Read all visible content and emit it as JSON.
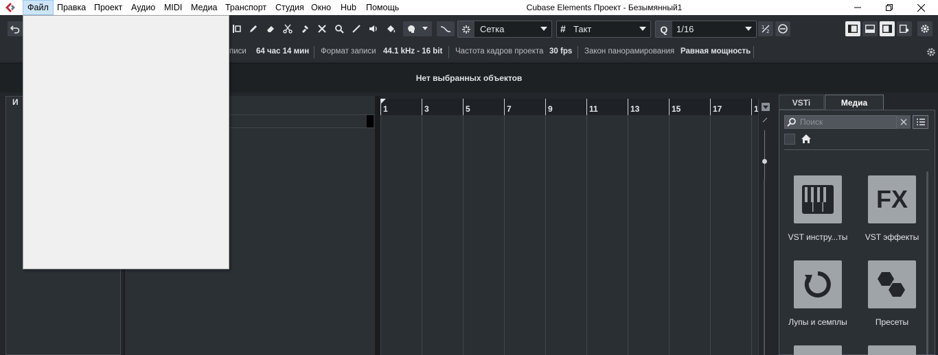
{
  "window": {
    "title": "Cubase Elements Проект - Безымянный1",
    "menu": [
      "Файл",
      "Правка",
      "Проект",
      "Аудио",
      "MIDI",
      "Медиа",
      "Транспорт",
      "Студия",
      "Окно",
      "Hub",
      "Помощь"
    ]
  },
  "toolbar": {
    "snap_type": "Сетка",
    "grid_type": "Такт",
    "quantize": "1/16"
  },
  "statusline": {
    "record_time_label_partial": "писи",
    "record_time_value": "64 час 14 мин",
    "record_format_label": "Формат записи",
    "record_format_value": "44.1 kHz - 16 bit",
    "frame_rate_label": "Частота кадров проекта",
    "frame_rate_value": "30 fps",
    "pan_law_label": "Закон панорамирования",
    "pan_law_value": "Равная мощность"
  },
  "infoline": {
    "text": "Нет выбранных объектов"
  },
  "inspector": {
    "title_partial": "И"
  },
  "ruler": {
    "bars": [
      "1",
      "3",
      "5",
      "7",
      "9",
      "11",
      "13",
      "15",
      "17",
      "1"
    ]
  },
  "right_zone": {
    "tabs": [
      "VSTi",
      "Медиа"
    ],
    "active_tab": "Медиа",
    "search_placeholder": "Поиск",
    "tiles": [
      {
        "label": "VST инстру...ты",
        "icon": "piano-keys-icon"
      },
      {
        "label": "VST эффекты",
        "icon": "fx-icon"
      },
      {
        "label": "Лупы и семплы",
        "icon": "loop-icon"
      },
      {
        "label": "Пресеты",
        "icon": "hexagons-icon"
      }
    ]
  },
  "colors": {
    "accent_red": "#c0283a",
    "menu_highlight": "#cce4f7",
    "panel_bg": "#23272b"
  }
}
